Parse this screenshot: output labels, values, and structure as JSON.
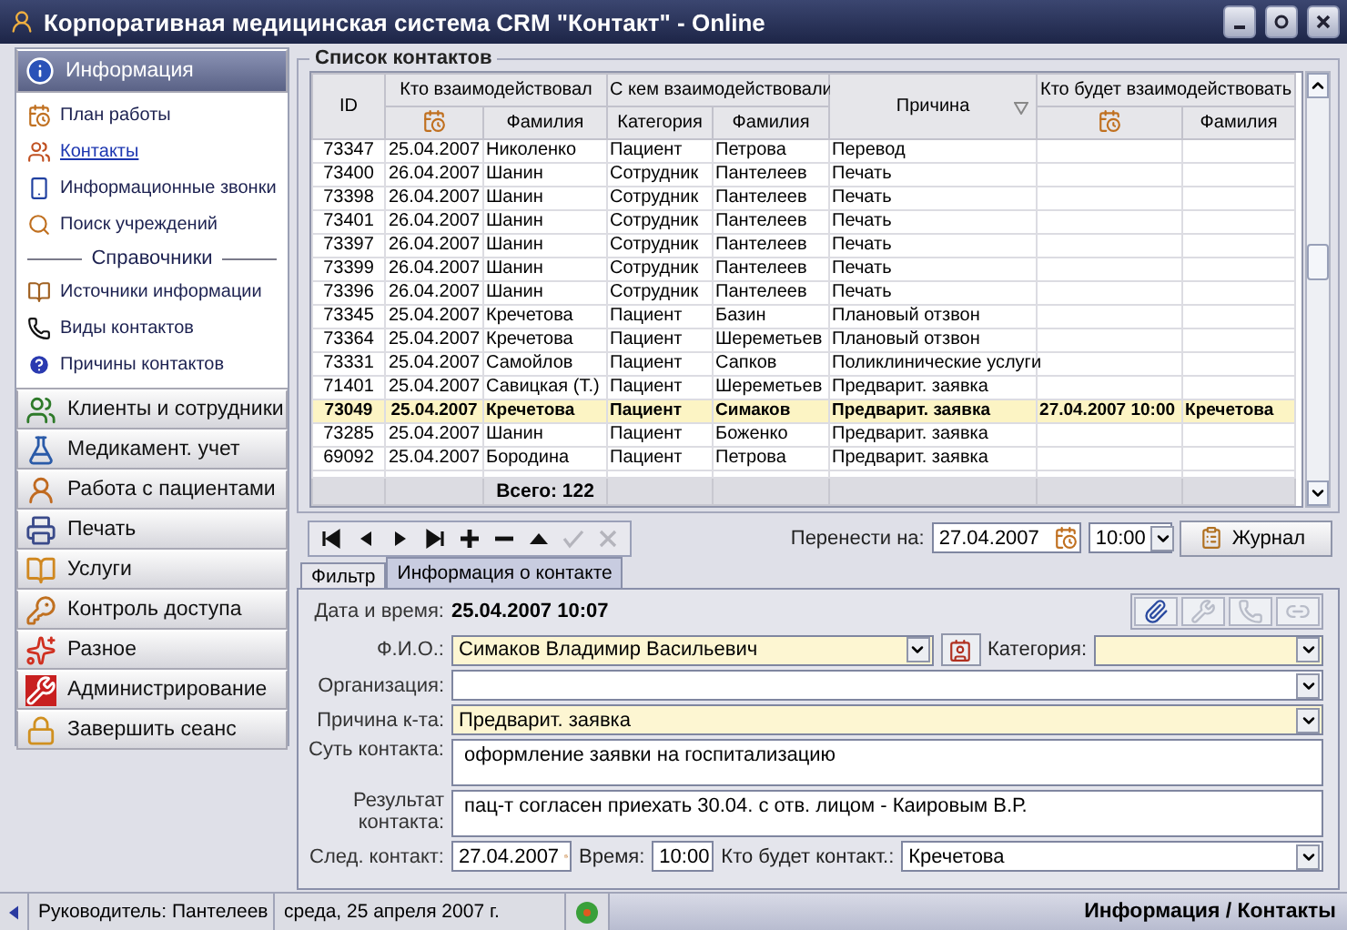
{
  "window": {
    "title": "Корпоративная медицинская система CRM \"Контакт\" - Online"
  },
  "sidebar": {
    "groups": [
      {
        "label": "Информация",
        "selected": true,
        "items": [
          {
            "kind": "item",
            "label": "План работы",
            "selected": false
          },
          {
            "kind": "item",
            "label": "Контакты",
            "selected": true
          },
          {
            "kind": "item",
            "label": "Информационные звонки",
            "selected": false
          },
          {
            "kind": "item",
            "label": "Поиск учреждений",
            "selected": false
          },
          {
            "kind": "heading",
            "label": "Справочники"
          },
          {
            "kind": "item",
            "label": "Источники информации",
            "selected": false
          },
          {
            "kind": "item",
            "label": "Виды контактов",
            "selected": false
          },
          {
            "kind": "item",
            "label": "Причины контактов",
            "selected": false
          }
        ]
      },
      {
        "label": "Клиенты и сотрудники",
        "selected": false
      },
      {
        "label": "Медикамент. учет",
        "selected": false
      },
      {
        "label": "Работа с пациентами",
        "selected": false
      },
      {
        "label": "Печать",
        "selected": false
      },
      {
        "label": "Услуги",
        "selected": false
      },
      {
        "label": "Контроль доступа",
        "selected": false
      },
      {
        "label": "Разное",
        "selected": false
      },
      {
        "label": "Администрирование",
        "selected": false
      },
      {
        "label": "Завершить сеанс",
        "selected": false
      }
    ]
  },
  "table": {
    "title": "Список контактов",
    "columns": [
      {
        "kind": "single",
        "label": "ID"
      },
      {
        "kind": "group",
        "label": "Кто взаимодействовал",
        "sub": [
          {
            "kind": "icon"
          },
          {
            "kind": "text",
            "label": "Фамилия"
          }
        ]
      },
      {
        "kind": "group",
        "label": "С кем взаимодействовали",
        "sub": [
          {
            "kind": "text",
            "label": "Категория"
          },
          {
            "kind": "text",
            "label": "Фамилия"
          }
        ]
      },
      {
        "kind": "single",
        "label": "Причина",
        "sorted": true
      },
      {
        "kind": "group",
        "label": "Кто будет взаимодействовать",
        "sub": [
          {
            "kind": "icon"
          },
          {
            "kind": "text",
            "label": "Фамилия"
          }
        ]
      }
    ],
    "rows": [
      {
        "id": "73347",
        "date": "25.04.2007",
        "by": "Николенко",
        "category": "Пациент",
        "with": "Петрова",
        "reason": "Перевод",
        "selected": false
      },
      {
        "id": "73400",
        "date": "26.04.2007",
        "by": "Шанин",
        "category": "Сотрудник",
        "with": "Пантелеев",
        "reason": "Печать",
        "selected": false
      },
      {
        "id": "73398",
        "date": "26.04.2007",
        "by": "Шанин",
        "category": "Сотрудник",
        "with": "Пантелеев",
        "reason": "Печать",
        "selected": false
      },
      {
        "id": "73401",
        "date": "26.04.2007",
        "by": "Шанин",
        "category": "Сотрудник",
        "with": "Пантелеев",
        "reason": "Печать",
        "selected": false
      },
      {
        "id": "73397",
        "date": "26.04.2007",
        "by": "Шанин",
        "category": "Сотрудник",
        "with": "Пантелеев",
        "reason": "Печать",
        "selected": false
      },
      {
        "id": "73399",
        "date": "26.04.2007",
        "by": "Шанин",
        "category": "Сотрудник",
        "with": "Пантелеев",
        "reason": "Печать",
        "selected": false
      },
      {
        "id": "73396",
        "date": "26.04.2007",
        "by": "Шанин",
        "category": "Сотрудник",
        "with": "Пантелеев",
        "reason": "Печать",
        "selected": false
      },
      {
        "id": "73345",
        "date": "25.04.2007",
        "by": "Кречетова",
        "category": "Пациент",
        "with": "Базин",
        "reason": "Плановый отзвон",
        "selected": false
      },
      {
        "id": "73364",
        "date": "25.04.2007",
        "by": "Кречетова",
        "category": "Пациент",
        "with": "Шереметьев",
        "reason": "Плановый отзвон",
        "selected": false
      },
      {
        "id": "73331",
        "date": "25.04.2007",
        "by": "Самойлов",
        "category": "Пациент",
        "with": "Сапков",
        "reason": "Поликлинические услуги",
        "selected": false
      },
      {
        "id": "71401",
        "date": "25.04.2007",
        "by": "Савицкая (Т.)",
        "category": "Пациент",
        "with": "Шереметьев",
        "reason": "Предварит. заявка",
        "selected": false
      },
      {
        "id": "73049",
        "date": "25.04.2007",
        "by": "Кречетова",
        "category": "Пациент",
        "with": "Симаков",
        "reason": "Предварит. заявка",
        "next_when": "27.04.2007 10:00",
        "next_who": "Кречетова",
        "selected": true
      },
      {
        "id": "73285",
        "date": "25.04.2007",
        "by": "Шанин",
        "category": "Пациент",
        "with": "Боженко",
        "reason": "Предварит. заявка",
        "selected": false
      },
      {
        "id": "69092",
        "date": "25.04.2007",
        "by": "Бородина",
        "category": "Пациент",
        "with": "Петрова",
        "reason": "Предварит. заявка",
        "selected": false
      }
    ],
    "total": "Всего: 122"
  },
  "toolbar": {
    "buttons": [
      {
        "kind": "first",
        "disabled": false
      },
      {
        "kind": "prev",
        "disabled": false
      },
      {
        "kind": "next",
        "disabled": false
      },
      {
        "kind": "last",
        "disabled": false
      },
      {
        "kind": "add",
        "disabled": false
      },
      {
        "kind": "delete",
        "disabled": false
      },
      {
        "kind": "up",
        "disabled": false
      },
      {
        "kind": "post",
        "disabled": true
      },
      {
        "kind": "cancel",
        "disabled": true
      }
    ],
    "move_label": "Перенести на:",
    "move_date": "27.04.2007",
    "move_time": "10:00",
    "journal_button": "Журнал"
  },
  "tabs": [
    {
      "label": "Фильтр",
      "selected": false
    },
    {
      "label": "Информация о контакте",
      "selected": true
    }
  ],
  "form": {
    "datetime_label": "Дата и время:",
    "datetime": "25.04.2007 10:07",
    "actions": [
      {
        "kind": "clip",
        "disabled": false
      },
      {
        "kind": "tools",
        "disabled": true
      },
      {
        "kind": "phone",
        "disabled": true
      },
      {
        "kind": "link",
        "disabled": true
      }
    ],
    "fio": {
      "label": "Ф.И.О.:",
      "value": "Симаков Владимир Васильевич",
      "highlighted": true
    },
    "category": {
      "label": "Категория:",
      "highlighted": true
    },
    "organization": {
      "label": "Организация:",
      "highlighted": false
    },
    "reason": {
      "label": "Причина к-та:",
      "value": "Предварит. заявка",
      "highlighted": true
    },
    "summary": {
      "label": "Суть контакта:",
      "value": "оформление заявки на госпитализацию"
    },
    "result": {
      "label": "Результат контакта:",
      "value": "пац-т согласен приехать 30.04. с отв. лицом - Каировым В.Р."
    },
    "next_label": "След. контакт:",
    "next_date": "27.04.2007",
    "time_label": "Время:",
    "time": "10:00",
    "who_label": "Кто будет контакт.:",
    "who": "Кречетова"
  },
  "status_bar": {
    "manager": "Руководитель: Пантелеев",
    "date": "среда, 25 апреля 2007 г.",
    "location": "Информация / Контакты"
  }
}
